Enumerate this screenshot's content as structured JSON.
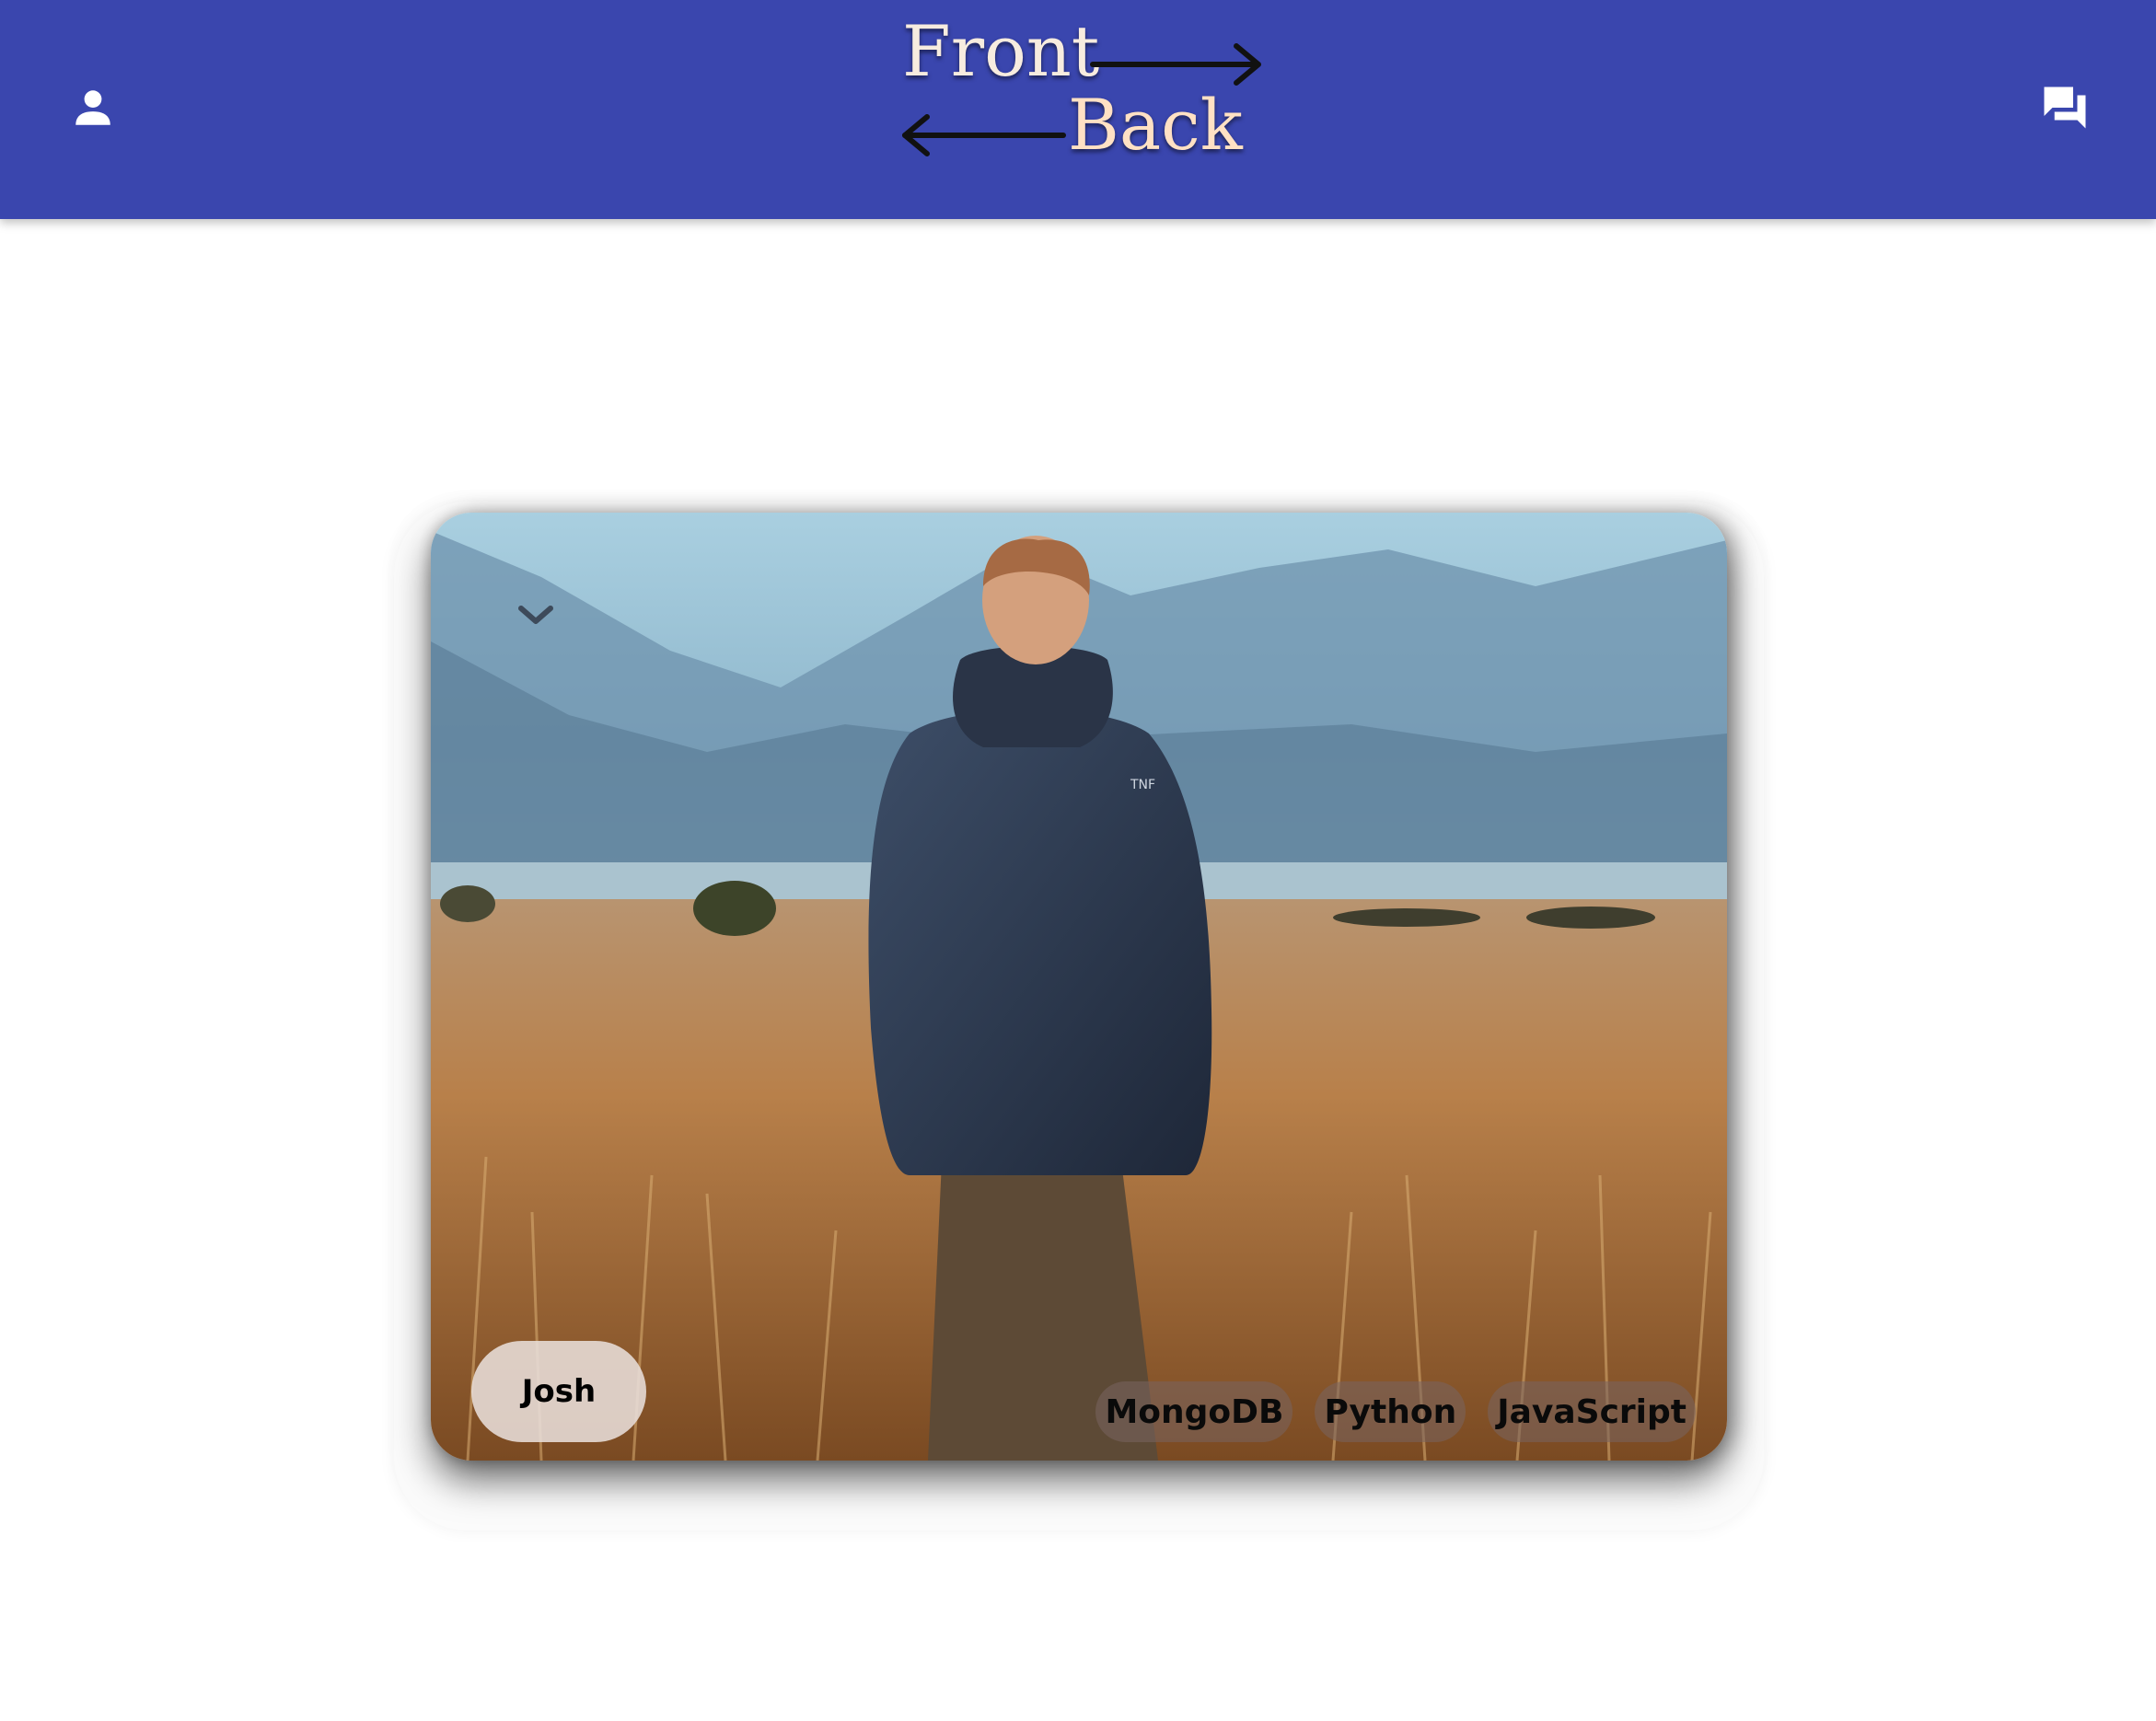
{
  "header": {
    "logo": {
      "word_top": "Front",
      "word_bottom": "Back"
    },
    "left_icon": "user-icon",
    "right_icon": "chat-icon",
    "background": "#3a46ae"
  },
  "card": {
    "image": "photo of person in dark jacket walking through golden grass field toward misty mountains",
    "toggle_icon": "chevron-down-icon",
    "name": "Josh",
    "tags": [
      "MongoDB",
      "Python",
      "JavaScript"
    ]
  }
}
